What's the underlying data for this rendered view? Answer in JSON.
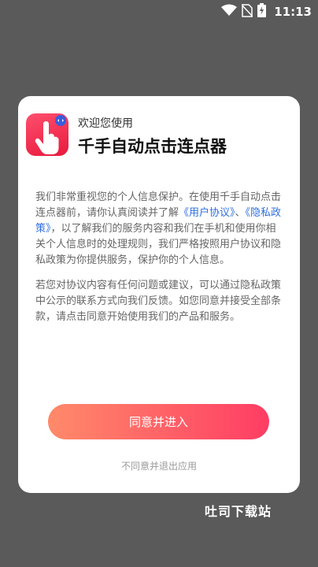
{
  "status_bar": {
    "time": "11:13",
    "icons": [
      "wifi-icon",
      "no-sim-icon",
      "battery-charging-icon"
    ]
  },
  "dialog": {
    "welcome": "欢迎您使用",
    "app_name": "千手自动点击连点器",
    "paragraph1": {
      "part1": "我们非常重视您的个人信息保护。在使用千手自动点击连点器前，请你认真阅读并了解",
      "link_user_agreement": "《用户协议》",
      "sep": "、",
      "link_privacy_policy": "《隐私政策》",
      "part2": "，以了解我们的服务内容和我们在手机和使用你相关个人信息时的处理规则，我们严格按照用户协议和隐私政策为你提供服务，保护你的个人信息。"
    },
    "paragraph2": "若您对协议内容有任何问题或建议，可以通过隐私政策中公示的联系方式向我们反馈。如您同意并接受全部条款，请点击同意开始使用我们的产品和服务。",
    "agree_button": "同意并进入",
    "disagree_link": "不同意并退出应用"
  },
  "watermark": "吐司下载站",
  "colors": {
    "accent": "#ff3d64",
    "link": "#2f6fe0",
    "overlay": "#5a5a5a"
  }
}
